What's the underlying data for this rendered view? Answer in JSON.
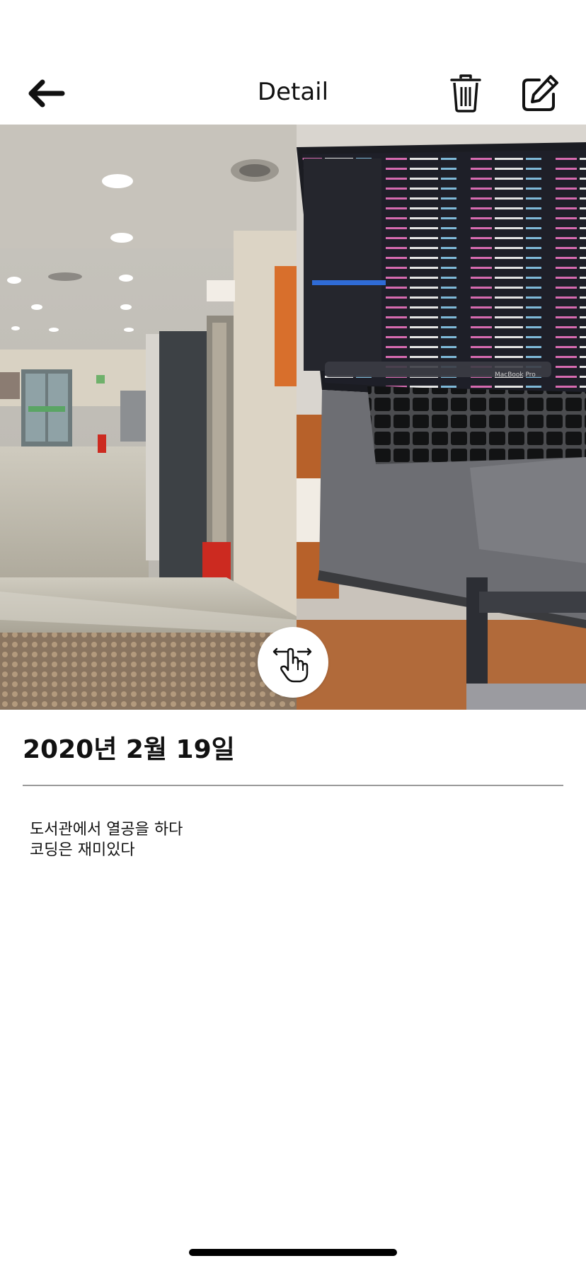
{
  "header": {
    "title": "Detail",
    "back_icon": "arrow-left-icon",
    "delete_icon": "trash-icon",
    "edit_icon": "pencil-square-icon"
  },
  "photos": {
    "before": {
      "description_icon": "library-hallway-photo"
    },
    "after": {
      "description_icon": "laptop-coding-photo",
      "laptop_brand": "MacBook Pro"
    },
    "swipe_handle_icon": "swipe-hand-icon"
  },
  "entry": {
    "date": "2020년 2월 19일",
    "memo_lines": [
      "도서관에서 열공을 하다",
      "코딩은 재미있다"
    ]
  },
  "colors": {
    "background": "#ffffff",
    "text": "#111111",
    "divider": "#9a9a9a"
  }
}
